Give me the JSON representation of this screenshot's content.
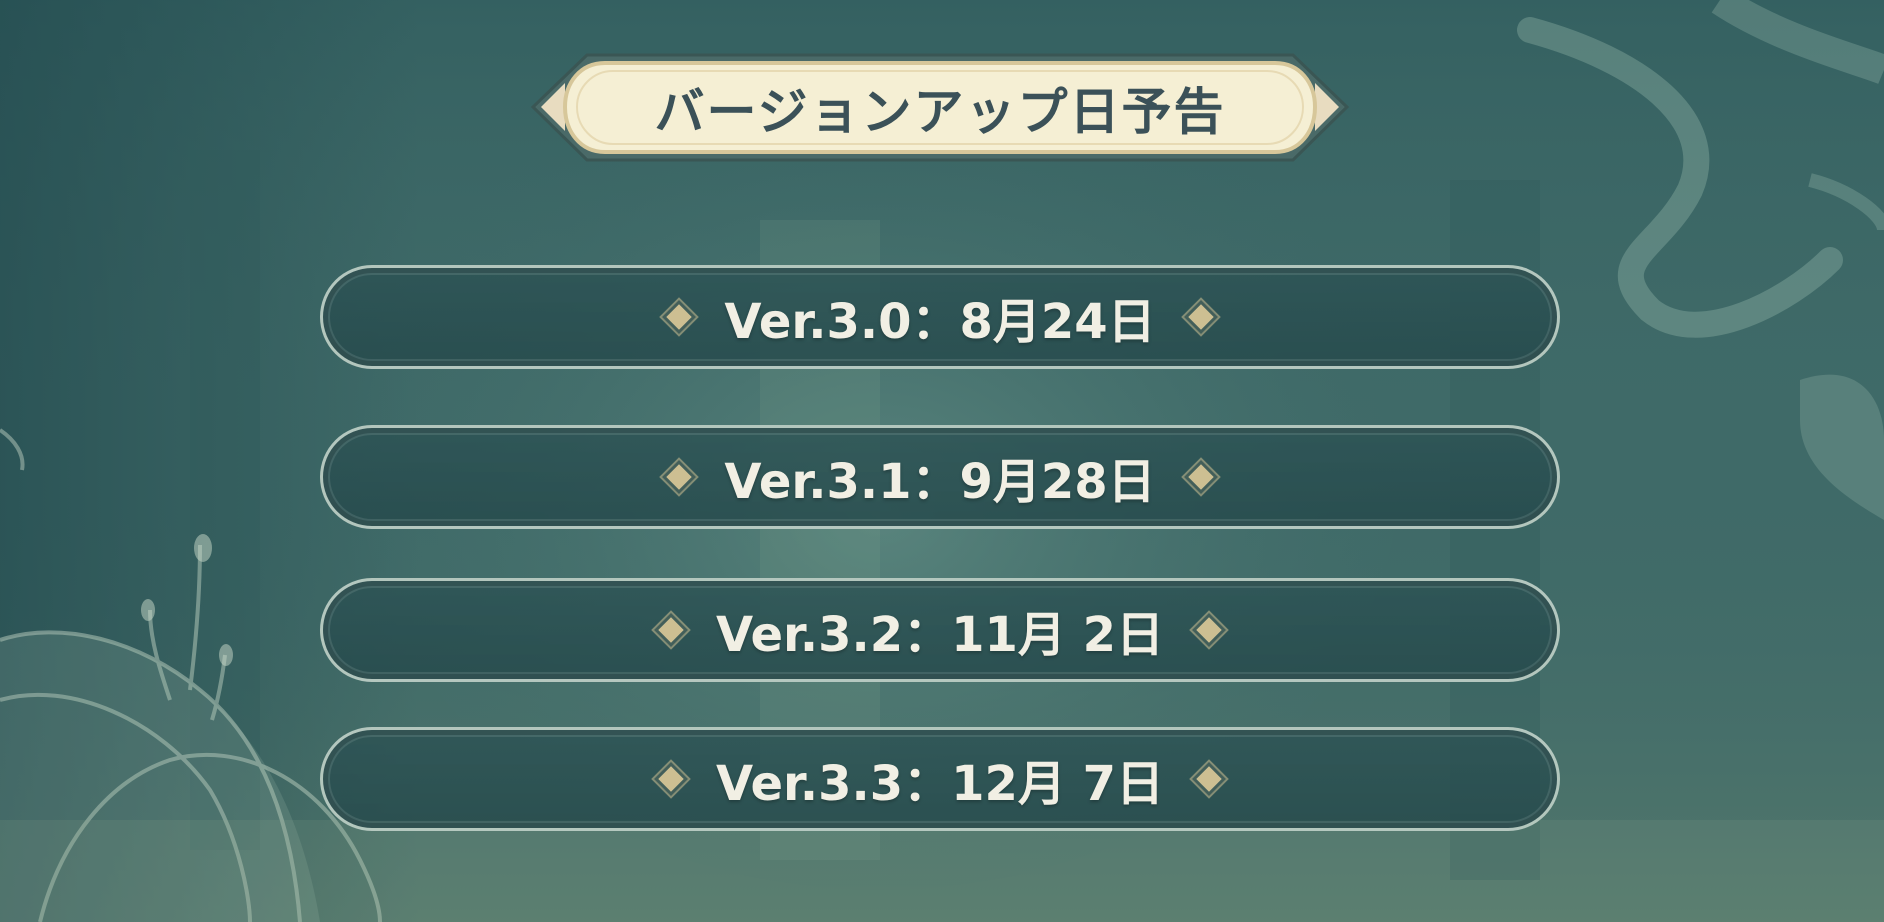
{
  "title": "バージョンアップ日予告",
  "versions": [
    {
      "label": "Ver.3.0：8月24日"
    },
    {
      "label": "Ver.3.1：9月28日"
    },
    {
      "label": "Ver.3.2：11月 2日"
    },
    {
      "label": "Ver.3.3：12月 7日"
    }
  ],
  "colors": {
    "background": "#3f6a68",
    "banner_fill": "#f5efd4",
    "banner_frame": "#b07a45",
    "title_text": "#3b5158",
    "row_text": "#f1efe4",
    "row_border": "#dae8dd",
    "diamond": "#cdbf92"
  }
}
